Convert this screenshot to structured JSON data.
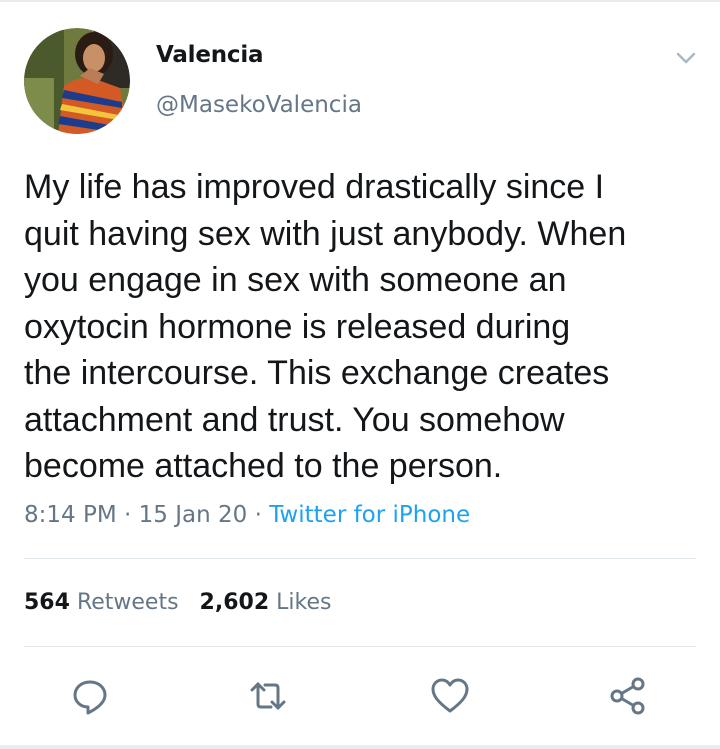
{
  "tweet": {
    "display_name": "Valencia",
    "handle": "@MasekoValencia",
    "text_lines": [
      "My life has improved drastically since I",
      "quit having sex with just anybody. When",
      "you engage in sex with someone an",
      "oxytocin hormone is released during",
      "the intercourse. This exchange creates",
      "attachment and trust. You somehow",
      "become attached to the person."
    ],
    "time": "8:14 PM",
    "date": "15 Jan 20",
    "separator": "·",
    "source": "Twitter for iPhone"
  },
  "stats": {
    "retweets_count": "564",
    "retweets_label": "Retweets",
    "likes_count": "2,602",
    "likes_label": "Likes"
  },
  "actions": {
    "icons": [
      "reply-icon",
      "retweet-icon",
      "like-icon",
      "share-icon"
    ]
  },
  "colors": {
    "text": "#14171a",
    "secondary": "#657786",
    "link": "#1da1f2",
    "divider": "#e1e8ed"
  }
}
